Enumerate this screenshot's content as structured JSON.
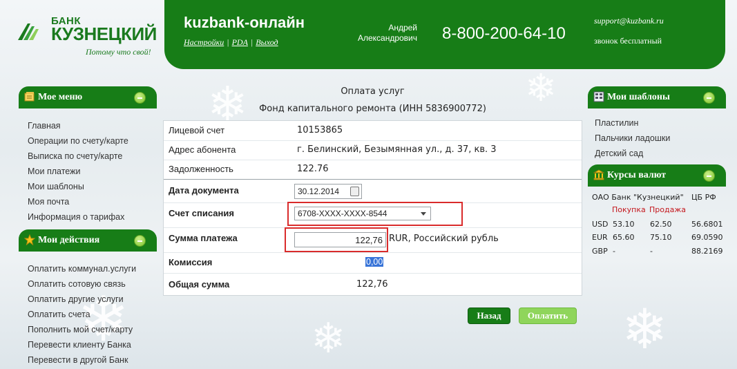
{
  "brand": {
    "name_small": "БАНК",
    "name_big": "КУЗНЕЦКИЙ",
    "tagline": "Потому что свой!",
    "color": "#177d17"
  },
  "header": {
    "title": "kuzbank-онлайн",
    "links": [
      "Настройки",
      "PDA",
      "Выход"
    ],
    "user_first": "Андрей",
    "user_last": "Александрович",
    "phone": "8-800-200-64-10",
    "email": "support@kuzbank.ru",
    "free_call": "звонок бесплатный"
  },
  "left": {
    "menu_title": "Мое меню",
    "menu_items": [
      "Главная",
      "Операции по счету/карте",
      "Выписка по счету/карте",
      "Мои платежи",
      "Мои шаблоны",
      "Моя почта",
      "Информация о тарифах"
    ],
    "actions_title": "Мои действия",
    "action_items": [
      "Оплатить коммунал.услуги",
      "Оплатить сотовую связь",
      "Оплатить другие услуги",
      "Оплатить счета",
      "Пополнить мой счет/карту",
      "Перевести клиенту Банка",
      "Перевести в другой Банк"
    ]
  },
  "form": {
    "title": "Оплата услуг",
    "subtitle": "Фонд капитального ремонта (ИНН 5836900772)",
    "account_label": "Лицевой счет",
    "account_value": "10153865",
    "address_label": "Адрес абонента",
    "address_value": "г. Белинский, Безымянная ул., д. 37, кв. 3",
    "debt_label": "Задолженность",
    "debt_value": "122.76",
    "doc_date_label": "Дата документа",
    "doc_date_value": "30.12.2014",
    "debit_label": "Счет списания",
    "debit_value": "6708-XXXX-XXXX-8544",
    "sum_label": "Сумма платежа",
    "sum_value": "122,76",
    "currency": "RUR, Российский рубль",
    "fee_label": "Комиссия",
    "fee_value": "0,00",
    "total_label": "Общая сумма",
    "total_value": "122,76",
    "back_button": "Назад",
    "pay_button": "Оплатить"
  },
  "right": {
    "templates_title": "Мои шаблоны",
    "templates": [
      "Пластилин",
      "Пальчики ладошки",
      "Детский сад"
    ],
    "rates_title": "Курсы валют",
    "rates_bank": "ОАО Банк \"Кузнецкий\"",
    "rates_cb": "ЦБ РФ",
    "rates_buy": "Покупка",
    "rates_sell": "Продажа",
    "rates": [
      {
        "cur": "USD",
        "buy": "53.10",
        "sell": "62.50",
        "cb": "56.6801"
      },
      {
        "cur": "EUR",
        "buy": "65.60",
        "sell": "75.10",
        "cb": "69.0590"
      },
      {
        "cur": "GBP",
        "buy": "-",
        "sell": "-",
        "cb": "88.2169"
      }
    ]
  }
}
